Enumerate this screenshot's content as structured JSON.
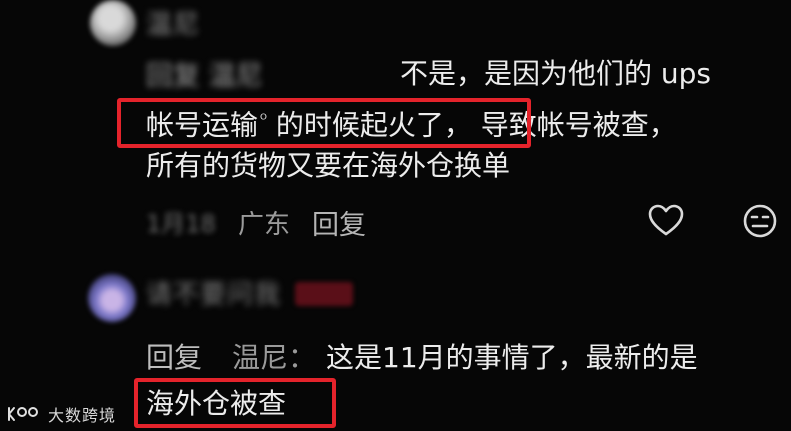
{
  "thread": {
    "comments": [
      {
        "user_name": "温尼",
        "avatar_icon": "user-avatar"
      },
      {
        "reply_prefix": "回复",
        "reply_target": "温尼",
        "text_line_1": "不是，是因为他们的 ups",
        "text_line_2a": "帐号运输",
        "text_line_2_mark": "ᴼ",
        "text_line_2b": "的时候起火了，",
        "text_line_2c": "导致帐号被查，",
        "text_line_3": "所有的货物又要在海外仓换单",
        "date": "1月18",
        "location": "广东",
        "reply_button": "回复",
        "like_icon": "heart-icon",
        "dislike_icon": "neutral-face-icon"
      },
      {
        "user_name": "请不要问我",
        "badge_color": "#5a0f18",
        "reply_prefix": "回复",
        "reply_target": "温尼：",
        "text_line_1": "这是11月的事情了，最新的是",
        "text_line_2": "海外仓被查"
      }
    ]
  },
  "highlight_color": "#e4232b",
  "watermark": {
    "logo_icon": "dashu-logo-icon",
    "text": "大数跨境"
  }
}
